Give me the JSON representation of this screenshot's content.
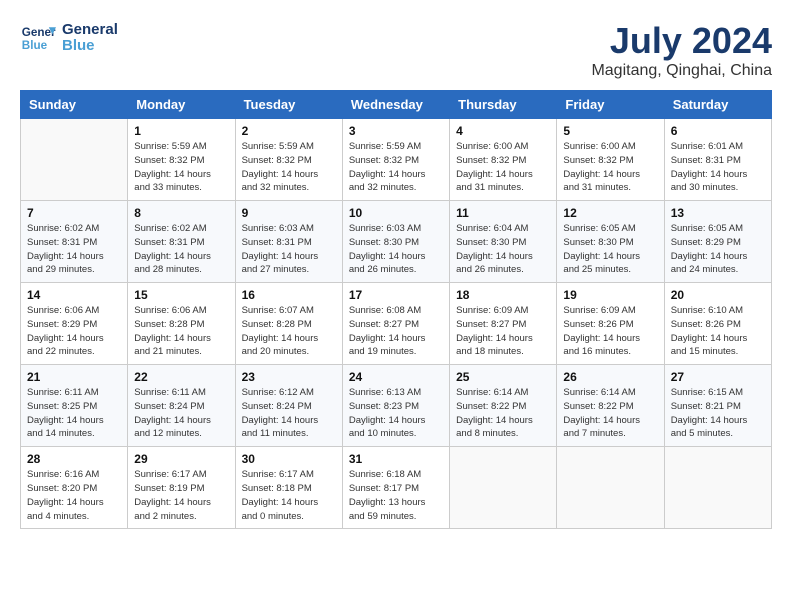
{
  "header": {
    "logo_line1": "General",
    "logo_line2": "Blue",
    "title": "July 2024",
    "subtitle": "Magitang, Qinghai, China"
  },
  "days_of_week": [
    "Sunday",
    "Monday",
    "Tuesday",
    "Wednesday",
    "Thursday",
    "Friday",
    "Saturday"
  ],
  "weeks": [
    [
      {
        "day": "",
        "info": ""
      },
      {
        "day": "1",
        "info": "Sunrise: 5:59 AM\nSunset: 8:32 PM\nDaylight: 14 hours\nand 33 minutes."
      },
      {
        "day": "2",
        "info": "Sunrise: 5:59 AM\nSunset: 8:32 PM\nDaylight: 14 hours\nand 32 minutes."
      },
      {
        "day": "3",
        "info": "Sunrise: 5:59 AM\nSunset: 8:32 PM\nDaylight: 14 hours\nand 32 minutes."
      },
      {
        "day": "4",
        "info": "Sunrise: 6:00 AM\nSunset: 8:32 PM\nDaylight: 14 hours\nand 31 minutes."
      },
      {
        "day": "5",
        "info": "Sunrise: 6:00 AM\nSunset: 8:32 PM\nDaylight: 14 hours\nand 31 minutes."
      },
      {
        "day": "6",
        "info": "Sunrise: 6:01 AM\nSunset: 8:31 PM\nDaylight: 14 hours\nand 30 minutes."
      }
    ],
    [
      {
        "day": "7",
        "info": "Sunrise: 6:02 AM\nSunset: 8:31 PM\nDaylight: 14 hours\nand 29 minutes."
      },
      {
        "day": "8",
        "info": "Sunrise: 6:02 AM\nSunset: 8:31 PM\nDaylight: 14 hours\nand 28 minutes."
      },
      {
        "day": "9",
        "info": "Sunrise: 6:03 AM\nSunset: 8:31 PM\nDaylight: 14 hours\nand 27 minutes."
      },
      {
        "day": "10",
        "info": "Sunrise: 6:03 AM\nSunset: 8:30 PM\nDaylight: 14 hours\nand 26 minutes."
      },
      {
        "day": "11",
        "info": "Sunrise: 6:04 AM\nSunset: 8:30 PM\nDaylight: 14 hours\nand 26 minutes."
      },
      {
        "day": "12",
        "info": "Sunrise: 6:05 AM\nSunset: 8:30 PM\nDaylight: 14 hours\nand 25 minutes."
      },
      {
        "day": "13",
        "info": "Sunrise: 6:05 AM\nSunset: 8:29 PM\nDaylight: 14 hours\nand 24 minutes."
      }
    ],
    [
      {
        "day": "14",
        "info": "Sunrise: 6:06 AM\nSunset: 8:29 PM\nDaylight: 14 hours\nand 22 minutes."
      },
      {
        "day": "15",
        "info": "Sunrise: 6:06 AM\nSunset: 8:28 PM\nDaylight: 14 hours\nand 21 minutes."
      },
      {
        "day": "16",
        "info": "Sunrise: 6:07 AM\nSunset: 8:28 PM\nDaylight: 14 hours\nand 20 minutes."
      },
      {
        "day": "17",
        "info": "Sunrise: 6:08 AM\nSunset: 8:27 PM\nDaylight: 14 hours\nand 19 minutes."
      },
      {
        "day": "18",
        "info": "Sunrise: 6:09 AM\nSunset: 8:27 PM\nDaylight: 14 hours\nand 18 minutes."
      },
      {
        "day": "19",
        "info": "Sunrise: 6:09 AM\nSunset: 8:26 PM\nDaylight: 14 hours\nand 16 minutes."
      },
      {
        "day": "20",
        "info": "Sunrise: 6:10 AM\nSunset: 8:26 PM\nDaylight: 14 hours\nand 15 minutes."
      }
    ],
    [
      {
        "day": "21",
        "info": "Sunrise: 6:11 AM\nSunset: 8:25 PM\nDaylight: 14 hours\nand 14 minutes."
      },
      {
        "day": "22",
        "info": "Sunrise: 6:11 AM\nSunset: 8:24 PM\nDaylight: 14 hours\nand 12 minutes."
      },
      {
        "day": "23",
        "info": "Sunrise: 6:12 AM\nSunset: 8:24 PM\nDaylight: 14 hours\nand 11 minutes."
      },
      {
        "day": "24",
        "info": "Sunrise: 6:13 AM\nSunset: 8:23 PM\nDaylight: 14 hours\nand 10 minutes."
      },
      {
        "day": "25",
        "info": "Sunrise: 6:14 AM\nSunset: 8:22 PM\nDaylight: 14 hours\nand 8 minutes."
      },
      {
        "day": "26",
        "info": "Sunrise: 6:14 AM\nSunset: 8:22 PM\nDaylight: 14 hours\nand 7 minutes."
      },
      {
        "day": "27",
        "info": "Sunrise: 6:15 AM\nSunset: 8:21 PM\nDaylight: 14 hours\nand 5 minutes."
      }
    ],
    [
      {
        "day": "28",
        "info": "Sunrise: 6:16 AM\nSunset: 8:20 PM\nDaylight: 14 hours\nand 4 minutes."
      },
      {
        "day": "29",
        "info": "Sunrise: 6:17 AM\nSunset: 8:19 PM\nDaylight: 14 hours\nand 2 minutes."
      },
      {
        "day": "30",
        "info": "Sunrise: 6:17 AM\nSunset: 8:18 PM\nDaylight: 14 hours\nand 0 minutes."
      },
      {
        "day": "31",
        "info": "Sunrise: 6:18 AM\nSunset: 8:17 PM\nDaylight: 13 hours\nand 59 minutes."
      },
      {
        "day": "",
        "info": ""
      },
      {
        "day": "",
        "info": ""
      },
      {
        "day": "",
        "info": ""
      }
    ]
  ]
}
